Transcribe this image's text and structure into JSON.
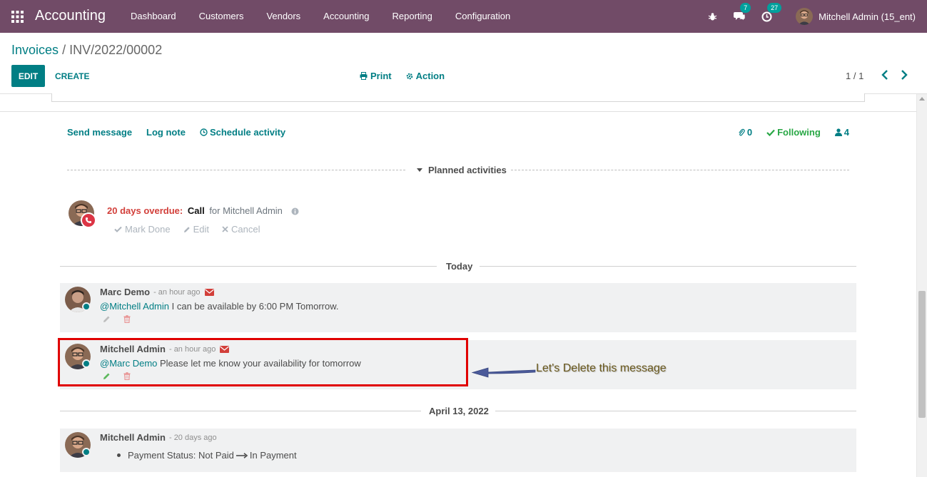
{
  "navbar": {
    "app_title": "Accounting",
    "menu": [
      "Dashboard",
      "Customers",
      "Vendors",
      "Accounting",
      "Reporting",
      "Configuration"
    ],
    "messages_count": "7",
    "activities_count": "27",
    "user": "Mitchell Admin (15_ent)"
  },
  "control_panel": {
    "breadcrumb_parent": "Invoices",
    "breadcrumb_sep": "/",
    "breadcrumb_current": "INV/2022/00002",
    "edit_label": "EDIT",
    "create_label": "CREATE",
    "print_label": "Print",
    "action_label": "Action",
    "pager": "1 / 1"
  },
  "chatter": {
    "send_message": "Send message",
    "log_note": "Log note",
    "schedule_activity": "Schedule activity",
    "attachments_count": "0",
    "following": "Following",
    "followers_count": "4",
    "planned_activities": "Planned activities",
    "activity": {
      "overdue": "20 days overdue:",
      "type": "Call",
      "for": "for Mitchell Admin",
      "mark_done": "Mark Done",
      "edit": "Edit",
      "cancel": "Cancel"
    },
    "today_label": "Today",
    "date_label": "April 13, 2022",
    "messages": [
      {
        "author": "Marc Demo",
        "date": "- an hour ago",
        "mention": "@Mitchell Admin",
        "text": " I can be available by 6:00 PM Tomorrow."
      },
      {
        "author": "Mitchell Admin",
        "date": "- an hour ago",
        "mention": "@Marc Demo",
        "text": " Please let me know your availability for tomorrow"
      },
      {
        "author": "Mitchell Admin",
        "date": "- 20 days ago",
        "tracking_label": "Payment Status: Not Paid",
        "tracking_new": "In Payment"
      }
    ]
  },
  "annotation": {
    "text": "Let's Delete this message"
  },
  "colors": {
    "brand": "#714b67",
    "accent": "#017e84",
    "danger": "#d23f3a",
    "highlight": "#e00000",
    "annotation_arrow": "#4b5a9a"
  }
}
